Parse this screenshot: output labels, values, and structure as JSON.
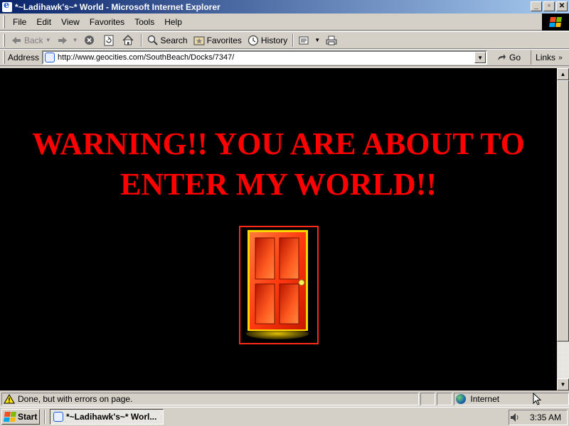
{
  "window": {
    "title": "*~Ladihawk's~* World - Microsoft Internet Explorer",
    "buttons": {
      "minimize": "_",
      "maximize": "▫",
      "close": "✕"
    }
  },
  "menu": {
    "items": [
      {
        "label": "File"
      },
      {
        "label": "Edit"
      },
      {
        "label": "View"
      },
      {
        "label": "Favorites"
      },
      {
        "label": "Tools"
      },
      {
        "label": "Help"
      }
    ]
  },
  "toolbar": {
    "back_label": "Back",
    "search_label": "Search",
    "favorites_label": "Favorites",
    "history_label": "History"
  },
  "address": {
    "label": "Address",
    "url": "http://www.geocities.com/SouthBeach/Docks/7347/",
    "go_label": "Go",
    "links_label": "Links"
  },
  "page": {
    "headline": "WARNING!! YOU ARE ABOUT TO ENTER MY WORLD!!",
    "headline_color": "#ff0000",
    "background_color": "#000000",
    "door_color": "#ff4a1a",
    "frame_color": "#ff2a1a",
    "door_image": "door-image"
  },
  "status": {
    "message": "Done, but with errors on page.",
    "zone": "Internet"
  },
  "taskbar": {
    "start_label": "Start",
    "task_label": "*~Ladihawk's~* Worl...",
    "clock": "3:35 AM"
  },
  "colors": {
    "titlebar_start": "#0a246a",
    "titlebar_end": "#a6caf0",
    "chrome": "#d4d0c8"
  }
}
